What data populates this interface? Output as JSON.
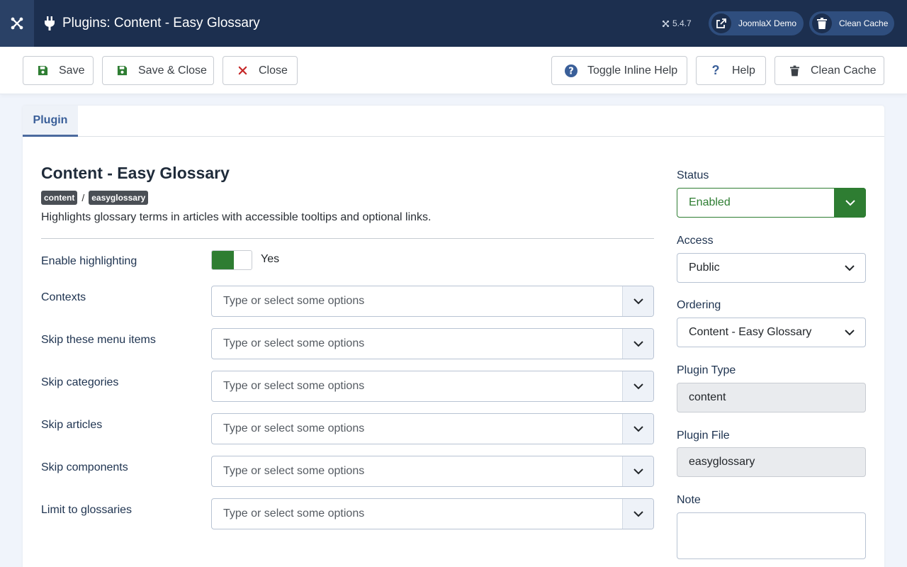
{
  "header": {
    "title": "Plugins: Content - Easy Glossary",
    "version": "5.4.7",
    "site_button": "JoomlaX Demo",
    "cache_button": "Clean Cache"
  },
  "toolbar": {
    "save": "Save",
    "save_close": "Save & Close",
    "close": "Close",
    "toggle_help": "Toggle Inline Help",
    "help": "Help",
    "clean_cache": "Clean Cache"
  },
  "tabs": [
    {
      "label": "Plugin"
    }
  ],
  "plugin": {
    "title": "Content - Easy Glossary",
    "group": "content",
    "element": "easyglossary",
    "separator": "/",
    "description": "Highlights glossary terms in articles with accessible tooltips and optional links."
  },
  "fields": {
    "highlighting": {
      "label": "Enable highlighting",
      "value": "Yes",
      "enabled": true
    },
    "multiselects": [
      {
        "label": "Contexts",
        "placeholder": "Type or select some options"
      },
      {
        "label": "Skip these menu items",
        "placeholder": "Type or select some options"
      },
      {
        "label": "Skip categories",
        "placeholder": "Type or select some options"
      },
      {
        "label": "Skip articles",
        "placeholder": "Type or select some options"
      },
      {
        "label": "Skip components",
        "placeholder": "Type or select some options"
      },
      {
        "label": "Limit to glossaries",
        "placeholder": "Type or select some options"
      }
    ]
  },
  "sidebar": {
    "status": {
      "label": "Status",
      "value": "Enabled"
    },
    "access": {
      "label": "Access",
      "value": "Public"
    },
    "ordering": {
      "label": "Ordering",
      "value": "Content - Easy Glossary"
    },
    "plugin_type": {
      "label": "Plugin Type",
      "value": "content"
    },
    "plugin_file": {
      "label": "Plugin File",
      "value": "easyglossary"
    },
    "note": {
      "label": "Note",
      "value": ""
    }
  },
  "colors": {
    "header_bg": "#1c2f4f",
    "accent": "#3a5f99",
    "success": "#2e7d32",
    "danger": "#c62828"
  }
}
